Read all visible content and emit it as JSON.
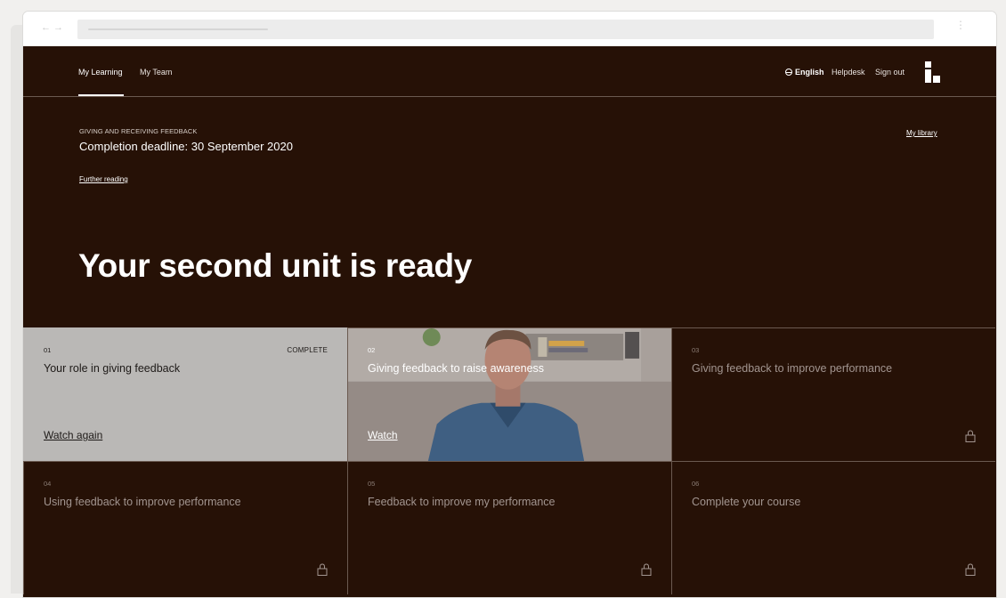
{
  "nav": {
    "tabs": [
      {
        "label": "My Learning",
        "active": true
      },
      {
        "label": "My Team",
        "active": false
      }
    ],
    "language": "English",
    "helpdesk": "Helpdesk",
    "signout": "Sign out"
  },
  "course": {
    "label": "GIVING AND RECEIVING FEEDBACK",
    "deadline": "Completion deadline: 30 September 2020",
    "further_reading": "Further reading",
    "library": "My library"
  },
  "headline": "Your second unit is ready",
  "units": [
    {
      "num": "01",
      "title": "Your role in giving feedback",
      "status": "COMPLETE",
      "action": "Watch again"
    },
    {
      "num": "02",
      "title": "Giving feedback to raise awareness",
      "action": "Watch"
    },
    {
      "num": "03",
      "title": "Giving feedback to improve performance",
      "locked": true
    },
    {
      "num": "04",
      "title": "Using feedback to improve performance",
      "locked": true
    },
    {
      "num": "05",
      "title": "Feedback to improve my performance",
      "locked": true
    },
    {
      "num": "06",
      "title": "Complete your course",
      "locked": true
    }
  ],
  "colors": {
    "background": "#261106",
    "complete_card": "#bab8b6",
    "divider": "#6b5a50"
  },
  "icons": [
    "back-arrow-icon",
    "forward-arrow-icon",
    "globe-icon",
    "brand-logo",
    "lock-icon",
    "more-dots-icon"
  ]
}
